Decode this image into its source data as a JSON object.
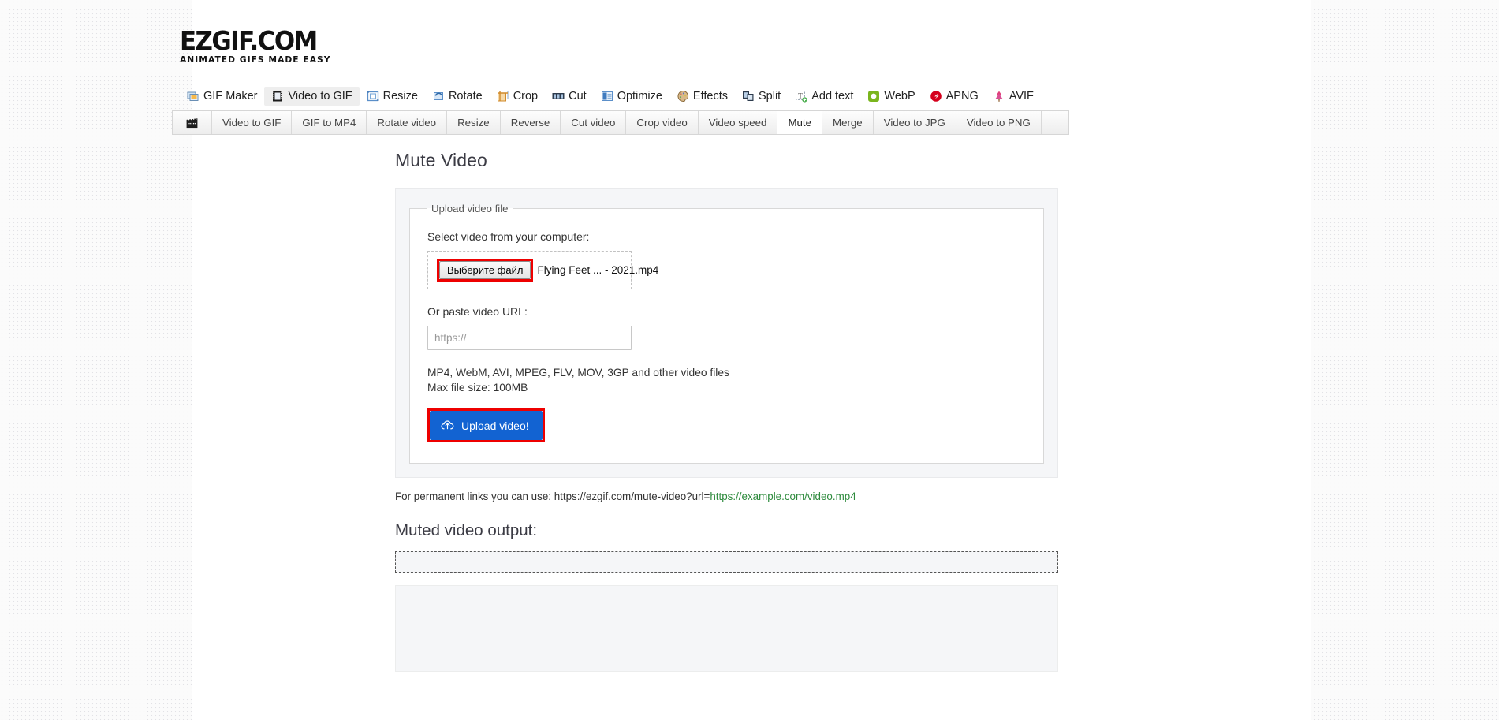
{
  "site": {
    "logo_main": "EZGIF.COM",
    "logo_tagline": "ANIMATED GIFS MADE EASY"
  },
  "main_nav": [
    {
      "label": "GIF Maker",
      "icon": "gif-maker-icon",
      "active": false
    },
    {
      "label": "Video to GIF",
      "icon": "video-to-gif-icon",
      "active": true
    },
    {
      "label": "Resize",
      "icon": "resize-icon",
      "active": false
    },
    {
      "label": "Rotate",
      "icon": "rotate-icon",
      "active": false
    },
    {
      "label": "Crop",
      "icon": "crop-icon",
      "active": false
    },
    {
      "label": "Cut",
      "icon": "cut-icon",
      "active": false
    },
    {
      "label": "Optimize",
      "icon": "optimize-icon",
      "active": false
    },
    {
      "label": "Effects",
      "icon": "effects-icon",
      "active": false
    },
    {
      "label": "Split",
      "icon": "split-icon",
      "active": false
    },
    {
      "label": "Add text",
      "icon": "add-text-icon",
      "active": false
    },
    {
      "label": "WebP",
      "icon": "webp-icon",
      "active": false
    },
    {
      "label": "APNG",
      "icon": "apng-icon",
      "active": false
    },
    {
      "label": "AVIF",
      "icon": "avif-icon",
      "active": false
    }
  ],
  "sub_nav": {
    "home_icon": "clapperboard-icon",
    "items": [
      {
        "label": "Video to GIF",
        "active": false
      },
      {
        "label": "GIF to MP4",
        "active": false
      },
      {
        "label": "Rotate video",
        "active": false
      },
      {
        "label": "Resize",
        "active": false
      },
      {
        "label": "Reverse",
        "active": false
      },
      {
        "label": "Cut video",
        "active": false
      },
      {
        "label": "Crop video",
        "active": false
      },
      {
        "label": "Video speed",
        "active": false
      },
      {
        "label": "Mute",
        "active": true
      },
      {
        "label": "Merge",
        "active": false
      },
      {
        "label": "Video to JPG",
        "active": false
      },
      {
        "label": "Video to PNG",
        "active": false
      }
    ]
  },
  "main": {
    "title": "Mute Video",
    "fieldset_legend": "Upload video file",
    "file_label": "Select video from your computer:",
    "file_button_label": "Выберите файл",
    "file_name": "Flying Feet ... - 2021.mp4",
    "url_label": "Or paste video URL:",
    "url_value": "",
    "url_placeholder": "https://",
    "formats_line": "MP4, WebM, AVI, MPEG, FLV, MOV, 3GP and other video files",
    "maxsize_line": "Max file size: 100MB",
    "upload_button_label": "Upload video!",
    "upload_icon": "cloud-upload-icon",
    "permalink_prefix": "For permanent links you can use: https://ezgif.com/mute-video?url=",
    "permalink_example": "https://example.com/video.mp4",
    "output_title": "Muted video output:"
  },
  "annotations": {
    "highlight_color": "#ee0000"
  }
}
